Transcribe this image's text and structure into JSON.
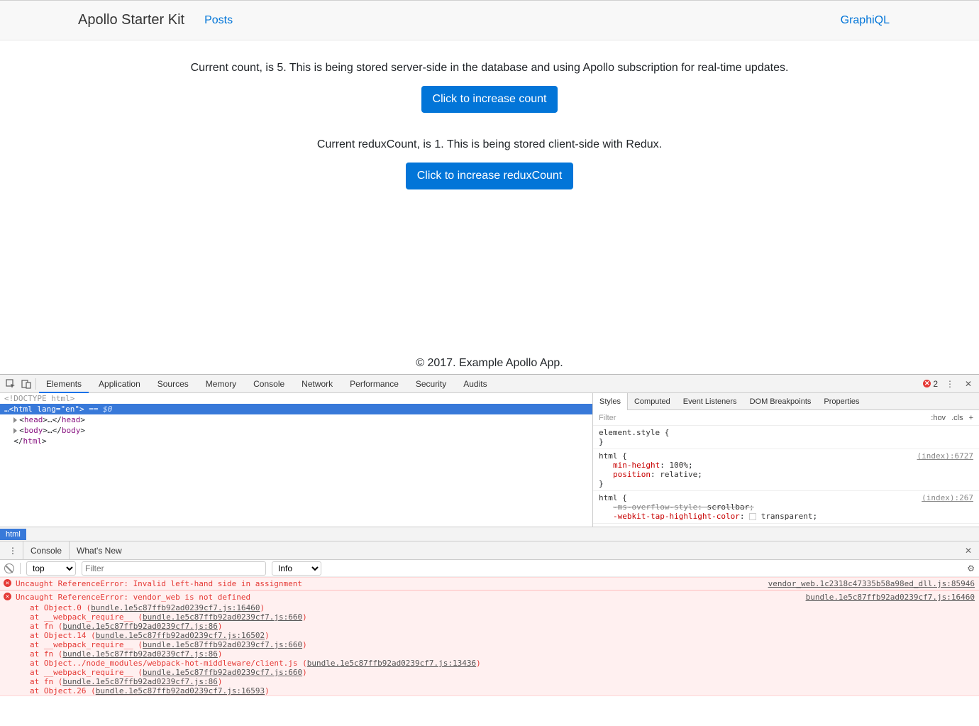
{
  "nav": {
    "brand": "Apollo Starter Kit",
    "link_posts": "Posts",
    "link_graphiql": "GraphiQL"
  },
  "content": {
    "count_text": "Current count, is 5. This is being stored server-side in the database and using Apollo subscription for real-time updates.",
    "btn_increase_count": "Click to increase count",
    "redux_text": "Current reduxCount, is 1. This is being stored client-side with Redux.",
    "btn_increase_redux": "Click to increase reduxCount"
  },
  "footer": {
    "text": "© 2017. Example Apollo App."
  },
  "devtools": {
    "tabs": [
      "Elements",
      "Application",
      "Sources",
      "Memory",
      "Console",
      "Network",
      "Performance",
      "Security",
      "Audits"
    ],
    "error_count": "2",
    "elements": {
      "doctype": "<!DOCTYPE html>",
      "html_open_prefix": "…",
      "html_tag": "html",
      "html_attr_name": "lang",
      "html_attr_val": "en",
      "eq0": " == $0",
      "head_open": "head",
      "head_ellipsis": "…",
      "head_close": "head",
      "body_open": "body",
      "body_ellipsis": "…",
      "body_close": "body",
      "html_close": "html",
      "crumb": "html"
    },
    "styles": {
      "tabs": [
        "Styles",
        "Computed",
        "Event Listeners",
        "DOM Breakpoints",
        "Properties"
      ],
      "filter_placeholder": "Filter",
      "hov": ":hov",
      "cls": ".cls",
      "rule1_sel": "element.style {",
      "rule1_close": "}",
      "rule2_sel": "html {",
      "rule2_src": "(index):6727",
      "rule2_p1_name": "min-height",
      "rule2_p1_val": "100%",
      "rule2_p2_name": "position",
      "rule2_p2_val": "relative",
      "rule2_close": "}",
      "rule3_sel": "html {",
      "rule3_src": "(index):267",
      "rule3_p1_name": "-ms-overflow-style",
      "rule3_p1_val": "scrollbar",
      "rule3_p2_name": "-webkit-tap-highlight-color",
      "rule3_p2_val": "transparent"
    },
    "drawer": {
      "tabs": [
        "Console",
        "What's New"
      ],
      "ctx": "top",
      "filter_placeholder": "Filter",
      "level": "Info"
    },
    "console": {
      "err1_msg": "Uncaught ReferenceError: Invalid left-hand side in assignment",
      "err1_src": "vendor_web.1c2318c47335b58a98ed_dll.js:85946",
      "err2_msg": "Uncaught ReferenceError: vendor_web is not defined",
      "err2_src": "bundle.1e5c87ffb92ad0239cf7.js:16460",
      "stack": [
        {
          "at": "at Object.0 (",
          "u": "bundle.1e5c87ffb92ad0239cf7.js:16460",
          "end": ")"
        },
        {
          "at": "at __webpack_require__  (",
          "u": "bundle.1e5c87ffb92ad0239cf7.js:660",
          "end": ")"
        },
        {
          "at": "at fn (",
          "u": "bundle.1e5c87ffb92ad0239cf7.js:86",
          "end": ")"
        },
        {
          "at": "at Object.14 (",
          "u": "bundle.1e5c87ffb92ad0239cf7.js:16502",
          "end": ")"
        },
        {
          "at": "at __webpack_require__  (",
          "u": "bundle.1e5c87ffb92ad0239cf7.js:660",
          "end": ")"
        },
        {
          "at": "at fn (",
          "u": "bundle.1e5c87ffb92ad0239cf7.js:86",
          "end": ")"
        },
        {
          "at": "at Object../node_modules/webpack-hot-middleware/client.js (",
          "u": "bundle.1e5c87ffb92ad0239cf7.js:13436",
          "end": ")"
        },
        {
          "at": "at __webpack_require__  (",
          "u": "bundle.1e5c87ffb92ad0239cf7.js:660",
          "end": ")"
        },
        {
          "at": "at fn (",
          "u": "bundle.1e5c87ffb92ad0239cf7.js:86",
          "end": ")"
        },
        {
          "at": "at Object.26 (",
          "u": "bundle.1e5c87ffb92ad0239cf7.js:16593",
          "end": ")"
        }
      ]
    }
  }
}
